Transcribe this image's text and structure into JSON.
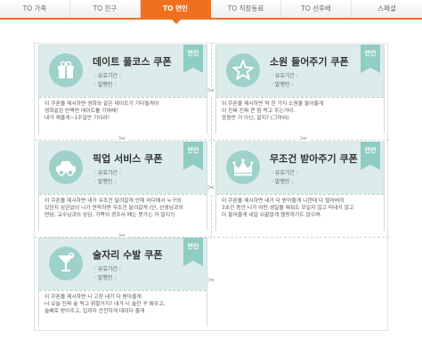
{
  "tabs": [
    {
      "label": "TO 가족"
    },
    {
      "label": "TO 친구"
    },
    {
      "label": "TO 연인",
      "active": true
    },
    {
      "label": "TO 직장동료"
    },
    {
      "label": "TO 선후배"
    },
    {
      "label": "스페셜"
    }
  ],
  "colors": {
    "accent": "#f0701f",
    "card_bg": "#dceceb",
    "ribbon": "#8fcdc2",
    "icon_bg": "#9ed1c9"
  },
  "meta_labels": {
    "period": "유효기간",
    "issuer": "발행인",
    "colon": ":"
  },
  "coupons": [
    {
      "title": "데이트 풀코스 쿠폰",
      "ribbon": "연인",
      "icon": "gift-box-icon",
      "desc": [
        "이 쿠폰을 제시하면 영화와 같은 데이트가 기다릴꺼야",
        "영화같은 반짝반 데이트를 기대해!",
        "내가 재울게~1주일만 기다려!"
      ]
    },
    {
      "title": "소원 들어주기 쿠폰",
      "ribbon": "연인",
      "icon": "star-icon",
      "desc": [
        "이 쿠폰을 제시하면 딱 한 가지 소원을 들어줄게",
        "이 진짜 진짜 큰 맘 먹고 주는거야.",
        "응원만 거 아닌, 알지? (그마워)"
      ]
    },
    {
      "title": "픽업 서비스 쿠폰",
      "ribbon": "연인",
      "icon": "car-icon",
      "desc": [
        "이 쿠폰을 제시하면 내가 무조건 달려갈게 언제 어디에서 누구와",
        "있던지 상관없이 니가 연락하면 무조건 달려갈게 (단, 선생님과의",
        "면담, 교수님과의 상담, 가족의 경조사 때는 못가는 거 알지?)"
      ]
    },
    {
      "title": "무조건 받아주기 쿠폰",
      "ribbon": "연인",
      "icon": "crown-icon",
      "desc": [
        "이 쿠폰을 제시하면 내가 다 받아줄게 니한테 다 털어버려",
        "3초간 동안 니가 어떤 생일을 해줘도 모일지 않고 떠내지 않고",
        "다 들어줄게 내일 뒤끝없게 행동하기도 않으며."
      ]
    },
    {
      "title": "술자리 수발 쿠폰",
      "ribbon": "연인",
      "icon": "cocktail-icon",
      "desc": [
        "이 쿠폰을 제시하면 니 고장 내가 다 받아줄게",
        "너 오늘 진짜 술 먹고 취할거지? 내가 니 술잔 꾸 예주고,",
        "술배로 받아주고, 집까지 안전하게 데려다 줄게"
      ]
    }
  ]
}
